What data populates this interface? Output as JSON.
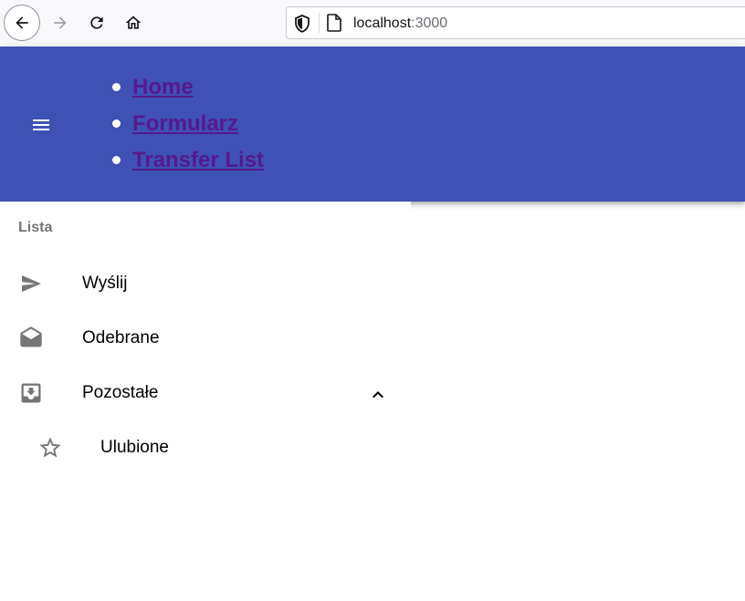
{
  "browser": {
    "url_host": "localhost",
    "url_port": ":3000"
  },
  "nav": {
    "links": [
      "Home",
      "Formularz",
      "Transfer List"
    ]
  },
  "drawer": {
    "subheader": "Lista",
    "items": [
      {
        "label": "Wyślij",
        "icon": "send-icon"
      },
      {
        "label": "Odebrane",
        "icon": "drafts-icon"
      },
      {
        "label": "Pozostałe",
        "icon": "move-to-inbox-icon",
        "expanded": true
      },
      {
        "label": "Ulubione",
        "icon": "star-border-icon",
        "nested": true
      }
    ]
  },
  "colors": {
    "app_bar": "#3f51b5",
    "link": "#551a8b",
    "icon_grey": "#757575"
  }
}
